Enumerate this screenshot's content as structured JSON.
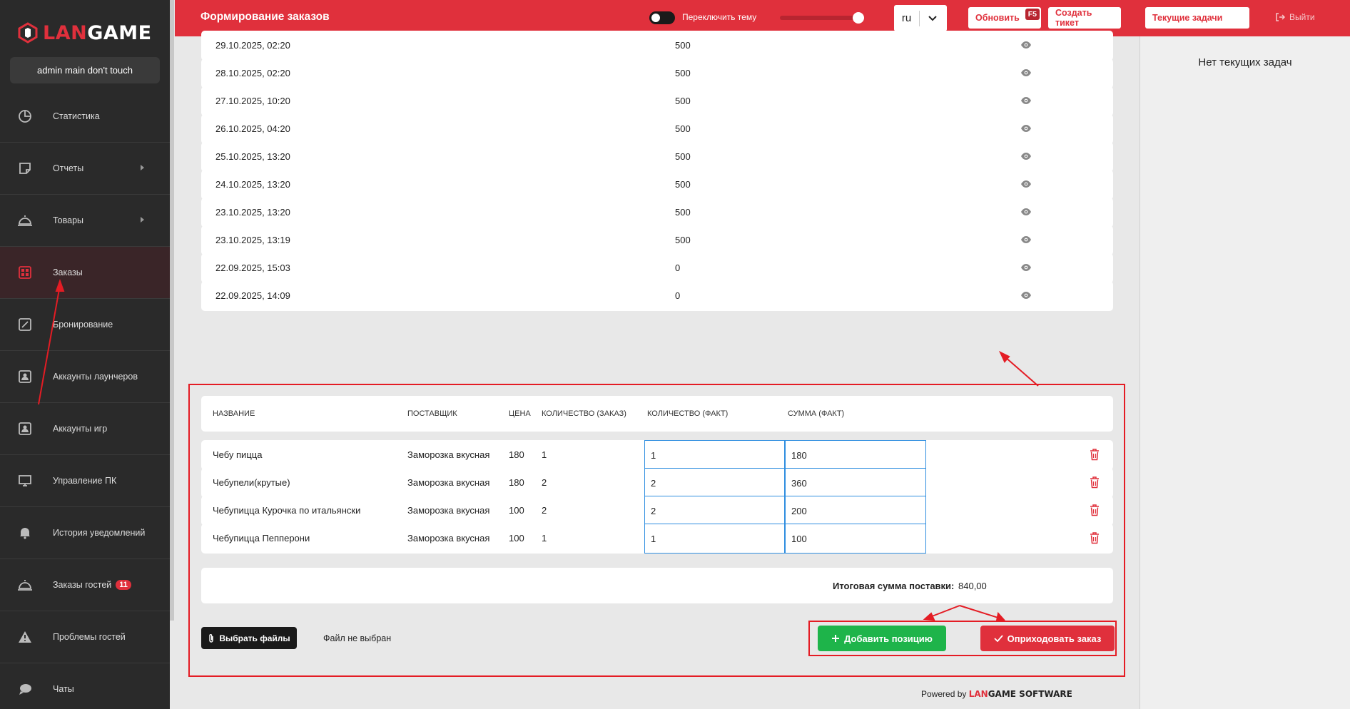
{
  "brand": {
    "logo_left": "LAN",
    "logo_right": "GAME"
  },
  "user": {
    "name": "admin main don't touch"
  },
  "sidebar": {
    "items": [
      {
        "label": "Статистика",
        "icon": "pie-chart-icon",
        "caret": false,
        "active": false
      },
      {
        "label": "Отчеты",
        "icon": "report-icon",
        "caret": true,
        "active": false
      },
      {
        "label": "Товары",
        "icon": "cloche-icon",
        "caret": true,
        "active": false
      },
      {
        "label": "Заказы",
        "icon": "grid-icon",
        "caret": false,
        "active": true
      },
      {
        "label": "Бронирование",
        "icon": "edit-icon",
        "caret": false,
        "active": false
      },
      {
        "label": "Аккаунты лаунчеров",
        "icon": "account-icon",
        "caret": false,
        "active": false
      },
      {
        "label": "Аккаунты игр",
        "icon": "account-icon",
        "caret": false,
        "active": false
      },
      {
        "label": "Управление ПК",
        "icon": "monitor-icon",
        "caret": false,
        "active": false
      },
      {
        "label": "История уведомлений",
        "icon": "bell-icon",
        "caret": false,
        "active": false
      },
      {
        "label": "Заказы гостей",
        "icon": "cloche-icon",
        "caret": false,
        "active": false,
        "badge": "11"
      },
      {
        "label": "Проблемы гостей",
        "icon": "warning-icon",
        "caret": false,
        "active": false
      },
      {
        "label": "Чаты",
        "icon": "chat-icon",
        "caret": false,
        "active": false
      }
    ]
  },
  "header": {
    "title": "Формирование заказов",
    "theme_label": "Переключить тему",
    "lang": "ru",
    "refresh_label": "Обновить",
    "refresh_key": "F5",
    "ticket_label": "Создать тикет",
    "tasks_label": "Текущие задачи",
    "logout_label": "Выйти"
  },
  "right_panel": {
    "empty_text": "Нет текущих задач"
  },
  "orders": [
    {
      "date": "29.10.2025, 02:20",
      "amount": "500"
    },
    {
      "date": "28.10.2025, 02:20",
      "amount": "500"
    },
    {
      "date": "27.10.2025, 10:20",
      "amount": "500"
    },
    {
      "date": "26.10.2025, 04:20",
      "amount": "500"
    },
    {
      "date": "25.10.2025, 13:20",
      "amount": "500"
    },
    {
      "date": "24.10.2025, 13:20",
      "amount": "500"
    },
    {
      "date": "23.10.2025, 13:20",
      "amount": "500"
    },
    {
      "date": "23.10.2025, 13:19",
      "amount": "500"
    },
    {
      "date": "22.09.2025, 15:03",
      "amount": "0"
    },
    {
      "date": "22.09.2025, 14:09",
      "amount": "0"
    }
  ],
  "products": {
    "columns": [
      "НАЗВАНИЕ",
      "ПОСТАВЩИК",
      "ЦЕНА",
      "КОЛИЧЕСТВО (ЗАКАЗ)",
      "КОЛИЧЕСТВО (ФАКТ)",
      "СУММА (ФАКТ)"
    ],
    "rows": [
      {
        "name": "Чебу пицца",
        "supplier": "Заморозка вкусная",
        "price": "180",
        "qty_order": "1",
        "qty_fact": "1",
        "sum_fact": "180"
      },
      {
        "name": "Чебупели(крутые)",
        "supplier": "Заморозка вкусная",
        "price": "180",
        "qty_order": "2",
        "qty_fact": "2",
        "sum_fact": "360"
      },
      {
        "name": "Чебупицца Курочка по итальянски",
        "supplier": "Заморозка вкусная",
        "price": "100",
        "qty_order": "2",
        "qty_fact": "2",
        "sum_fact": "200"
      },
      {
        "name": "Чебупицца Пепперони",
        "supplier": "Заморозка вкусная",
        "price": "100",
        "qty_order": "1",
        "qty_fact": "1",
        "sum_fact": "100"
      }
    ],
    "total_label": "Итоговая сумма поставки:",
    "total_value": "840,00"
  },
  "files": {
    "button_label": "Выбрать файлы",
    "status": "Файл не выбран"
  },
  "actions": {
    "add_label": "Добавить позицию",
    "receive_label": "Оприходовать заказ"
  },
  "footer": {
    "powered_by": "Powered by",
    "brand_left": "LAN",
    "brand_right": "GAME",
    "brand_suffix": "SOFTWARE"
  },
  "colors": {
    "accent": "#e0303c",
    "success": "#1eb44a",
    "sidebar": "#2a2a2a",
    "annotation": "#e41c24"
  }
}
